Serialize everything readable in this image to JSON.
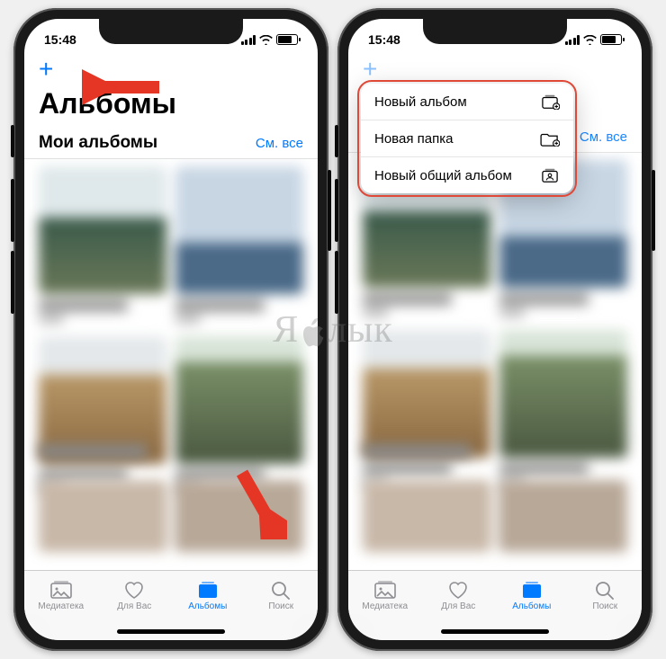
{
  "status": {
    "time": "15:48"
  },
  "nav": {
    "title": "Альбомы"
  },
  "section": {
    "title": "Мои альбомы",
    "see_all": "См. все"
  },
  "tabs": {
    "library": "Медиатека",
    "foryou": "Для Вас",
    "albums": "Альбомы",
    "search": "Поиск"
  },
  "popup": {
    "new_album": "Новый альбом",
    "new_folder": "Новая папка",
    "new_shared": "Новый общий альбом"
  },
  "watermark": {
    "left": "Я",
    "right": "лык"
  }
}
